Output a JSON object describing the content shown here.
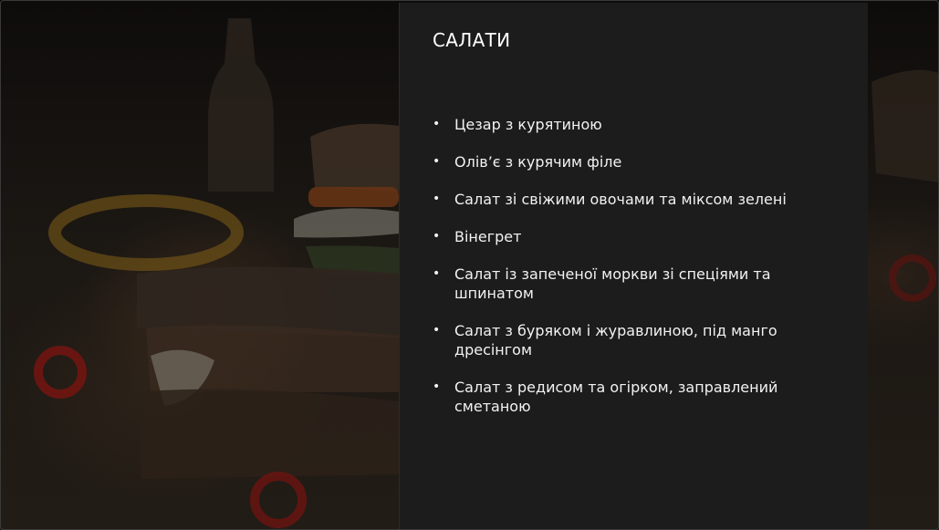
{
  "slide": {
    "title": "САЛАТИ",
    "items": [
      "Цезар з курятиною",
      "Олів’є з курячим філе",
      "Салат зі свіжими овочами та міксом зелені",
      "Вінегрет",
      "Салат із запеченої моркви зі спеціями та шпинатом",
      "Салат з буряком і журавлиною, під манго дресінгом",
      "Салат з редисом та огірком, заправлений сметаною"
    ],
    "bullet": "•"
  },
  "colors": {
    "panel_background": "#1c1c1c",
    "text": "#f2f2f2",
    "title": "#ffffff"
  }
}
